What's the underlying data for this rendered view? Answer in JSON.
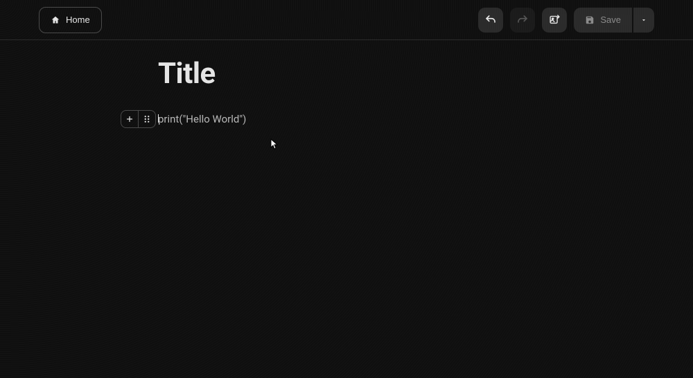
{
  "header": {
    "home_label": "Home",
    "save_label": "Save"
  },
  "document": {
    "title": "Title",
    "block_content": "print(\"Hello World\")"
  },
  "icons": {
    "home": "home-icon",
    "undo": "undo-icon",
    "redo": "redo-icon",
    "image": "image-icon",
    "save": "save-icon",
    "chevron": "chevron-down-icon",
    "plus": "plus-icon",
    "drag": "drag-handle-icon"
  }
}
